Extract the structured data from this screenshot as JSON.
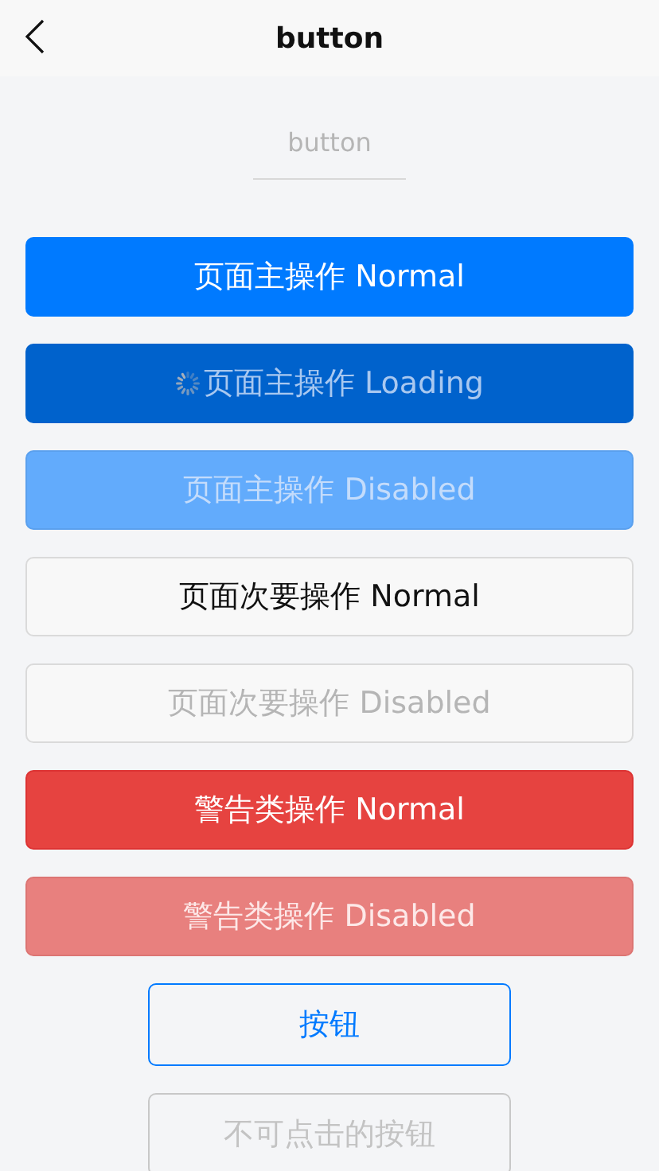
{
  "header": {
    "title": "button"
  },
  "section_title": "button",
  "buttons": [
    {
      "label": "页面主操作 Normal",
      "kind": "primary",
      "mini": false,
      "disabled": false,
      "loading": false
    },
    {
      "label": "页面主操作 Loading",
      "kind": "primary",
      "mini": false,
      "disabled": false,
      "loading": true
    },
    {
      "label": "页面主操作 Disabled",
      "kind": "primary",
      "mini": false,
      "disabled": true,
      "loading": false
    },
    {
      "label": "页面次要操作 Normal",
      "kind": "default",
      "mini": false,
      "disabled": false,
      "loading": false
    },
    {
      "label": "页面次要操作 Disabled",
      "kind": "default",
      "mini": false,
      "disabled": true,
      "loading": false
    },
    {
      "label": "警告类操作 Normal",
      "kind": "warn",
      "mini": false,
      "disabled": false,
      "loading": false
    },
    {
      "label": "警告类操作 Disabled",
      "kind": "warn",
      "mini": false,
      "disabled": true,
      "loading": false
    },
    {
      "label": "按钮",
      "kind": "plain",
      "mini": true,
      "disabled": false,
      "loading": false
    },
    {
      "label": "不可点击的按钮",
      "kind": "plain",
      "mini": true,
      "disabled": true,
      "loading": false
    }
  ]
}
